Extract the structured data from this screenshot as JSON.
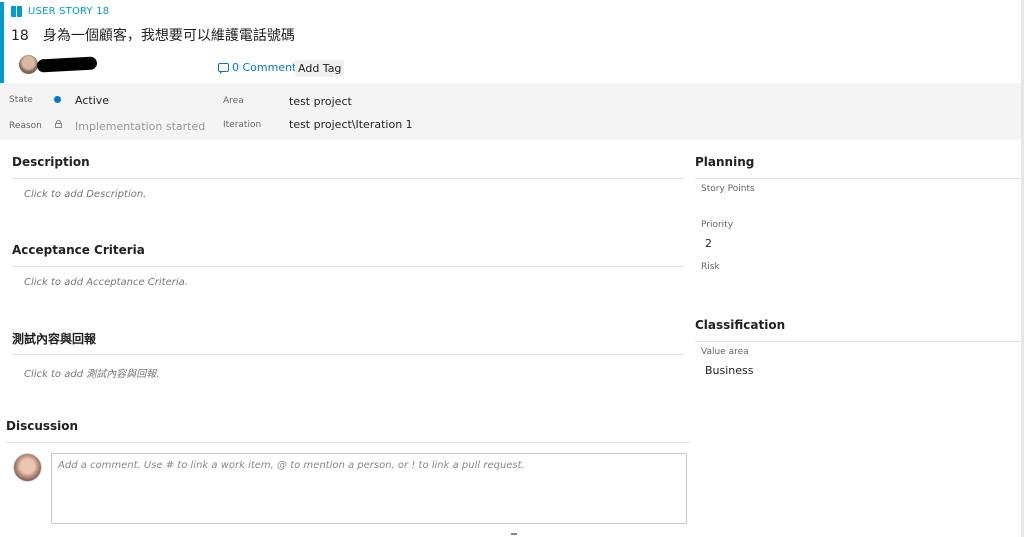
{
  "header": {
    "type_label": "USER STORY 18",
    "id": "18",
    "title": "身為一個顧客，我想要可以維護電話號碼",
    "comments_link": "0 Comments",
    "add_tag": "Add Tag"
  },
  "fields": {
    "state_label": "State",
    "state_value": "Active",
    "reason_label": "Reason",
    "reason_value": "Implementation started",
    "area_label": "Area",
    "area_value": "test project",
    "iteration_label": "Iteration",
    "iteration_value": "test project\\Iteration 1"
  },
  "sections": {
    "description_title": "Description",
    "description_placeholder": "Click to add Description.",
    "acceptance_title": "Acceptance Criteria",
    "acceptance_placeholder": "Click to add Acceptance Criteria.",
    "testing_title": "測試內容與回報",
    "testing_placeholder": "Click to add 測試內容與回報."
  },
  "planning": {
    "title": "Planning",
    "story_points_label": "Story Points",
    "story_points_value": "",
    "priority_label": "Priority",
    "priority_value": "2",
    "risk_label": "Risk",
    "risk_value": ""
  },
  "classification": {
    "title": "Classification",
    "value_area_label": "Value area",
    "value_area_value": "Business"
  },
  "discussion": {
    "title": "Discussion",
    "comment_placeholder": "Add a comment. Use # to link a work item, @ to mention a person, or ! to link a pull request."
  },
  "colors": {
    "accent": "#009ccc",
    "link": "#0078d7",
    "state_active": "#0078d7"
  },
  "icons": [
    "book-icon",
    "comment-icon",
    "state-dot-icon",
    "lock-icon",
    "avatar"
  ]
}
